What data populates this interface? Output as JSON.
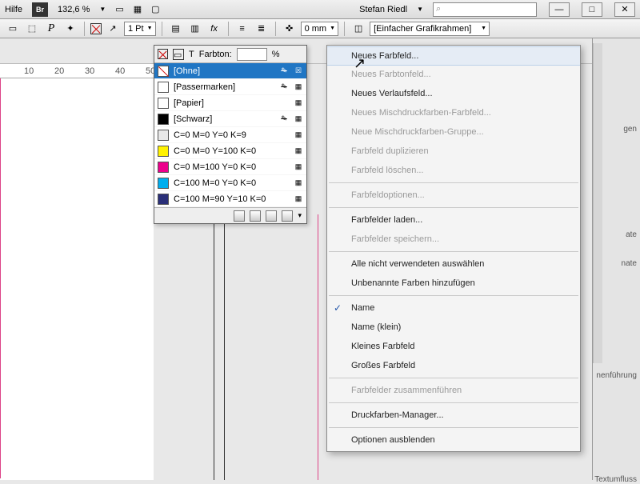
{
  "menubar": {
    "help": "Hilfe",
    "bridge_label": "Br",
    "zoom": "132,6 %",
    "user": "Stefan Riedl",
    "search_placeholder": ""
  },
  "toolbar": {
    "stroke_weight": "1 Pt",
    "x_offset": "0 mm",
    "frame_type": "[Einfacher Grafikrahmen]",
    "farbton_label": "Farbton:",
    "percent": "%"
  },
  "swatches": {
    "items": [
      {
        "name": "[Ohne]",
        "color": "#ffffff",
        "crossed": true,
        "selected": true,
        "editable": false
      },
      {
        "name": "[Passermarken]",
        "color": "#ffffff",
        "crossed": false,
        "selected": false,
        "editable": false
      },
      {
        "name": "[Papier]",
        "color": "#ffffff",
        "crossed": false,
        "selected": false,
        "editable": true
      },
      {
        "name": "[Schwarz]",
        "color": "#000000",
        "crossed": false,
        "selected": false,
        "editable": false
      },
      {
        "name": "C=0 M=0 Y=0 K=9",
        "color": "#e8e8e8",
        "crossed": false,
        "selected": false,
        "editable": true
      },
      {
        "name": "C=0 M=0 Y=100 K=0",
        "color": "#fff200",
        "crossed": false,
        "selected": false,
        "editable": true
      },
      {
        "name": "C=0 M=100 Y=0 K=0",
        "color": "#ec008c",
        "crossed": false,
        "selected": false,
        "editable": true
      },
      {
        "name": "C=100 M=0 Y=0 K=0",
        "color": "#00aeef",
        "crossed": false,
        "selected": false,
        "editable": true
      },
      {
        "name": "C=100 M=90 Y=10 K=0",
        "color": "#2a2f78",
        "crossed": false,
        "selected": false,
        "editable": true
      }
    ]
  },
  "context_menu": {
    "groups": [
      [
        {
          "label": "Neues Farbfeld...",
          "enabled": true,
          "checked": false,
          "hover": true
        },
        {
          "label": "Neues Farbtonfeld...",
          "enabled": false,
          "checked": false
        },
        {
          "label": "Neues Verlaufsfeld...",
          "enabled": true,
          "checked": false
        },
        {
          "label": "Neues Mischdruckfarben-Farbfeld...",
          "enabled": false,
          "checked": false
        },
        {
          "label": "Neue Mischdruckfarben-Gruppe...",
          "enabled": false,
          "checked": false
        },
        {
          "label": "Farbfeld duplizieren",
          "enabled": false,
          "checked": false
        },
        {
          "label": "Farbfeld löschen...",
          "enabled": false,
          "checked": false
        }
      ],
      [
        {
          "label": "Farbfeldoptionen...",
          "enabled": false,
          "checked": false
        }
      ],
      [
        {
          "label": "Farbfelder laden...",
          "enabled": true,
          "checked": false
        },
        {
          "label": "Farbfelder speichern...",
          "enabled": false,
          "checked": false
        }
      ],
      [
        {
          "label": "Alle nicht verwendeten auswählen",
          "enabled": true,
          "checked": false
        },
        {
          "label": "Unbenannte Farben hinzufügen",
          "enabled": true,
          "checked": false
        }
      ],
      [
        {
          "label": "Name",
          "enabled": true,
          "checked": true
        },
        {
          "label": "Name (klein)",
          "enabled": true,
          "checked": false
        },
        {
          "label": "Kleines Farbfeld",
          "enabled": true,
          "checked": false
        },
        {
          "label": "Großes Farbfeld",
          "enabled": true,
          "checked": false
        }
      ],
      [
        {
          "label": "Farbfelder zusammenführen",
          "enabled": false,
          "checked": false
        }
      ],
      [
        {
          "label": "Druckfarben-Manager...",
          "enabled": true,
          "checked": false
        }
      ],
      [
        {
          "label": "Optionen ausblenden",
          "enabled": true,
          "checked": false
        }
      ]
    ]
  },
  "side_tabs": {
    "items": [
      "gen",
      "ate",
      "nate",
      "nenführung",
      "Textumfluss"
    ]
  },
  "ruler": {
    "ticks": [
      "10",
      "20",
      "30",
      "40",
      "50"
    ]
  }
}
